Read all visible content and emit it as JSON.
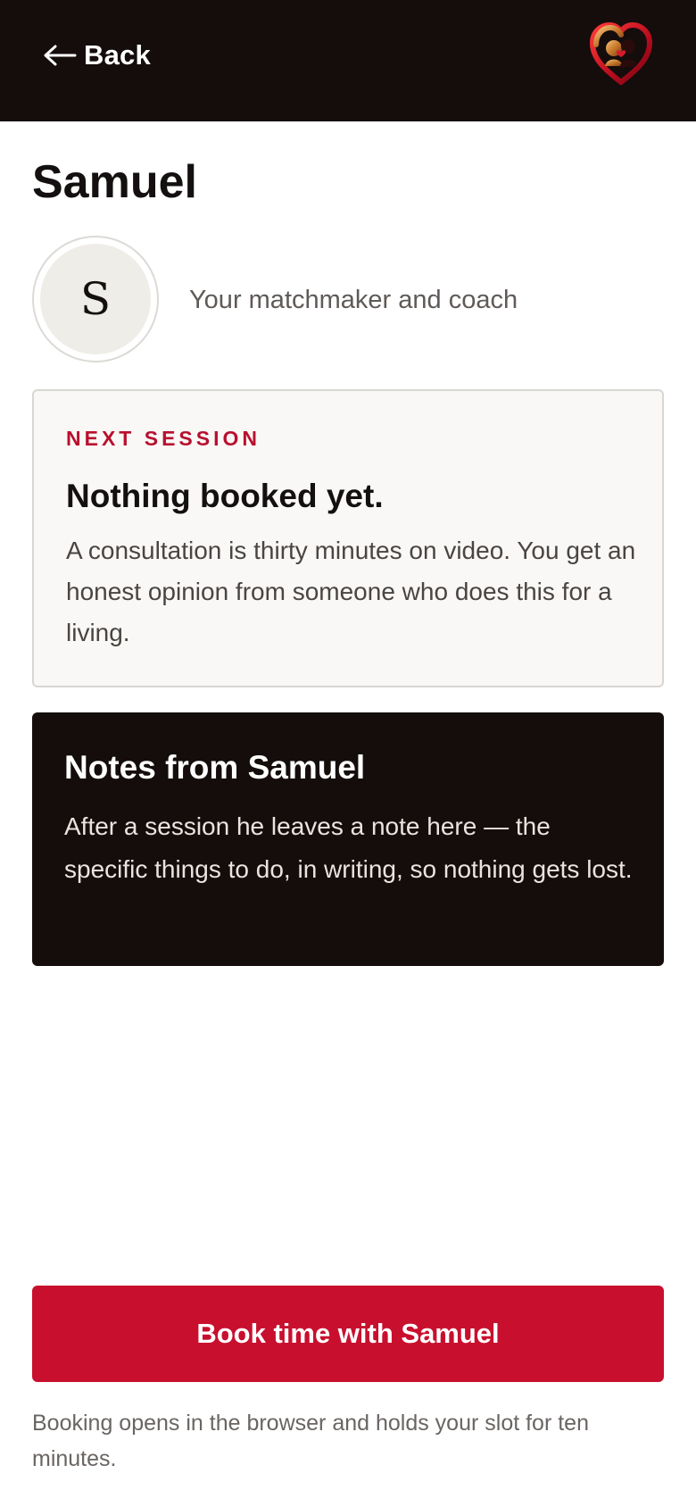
{
  "header": {
    "back_label": "Back",
    "logo_icon": "heart-couple-logo-icon"
  },
  "profile": {
    "name": "Samuel",
    "avatar_initial": "S",
    "role": "Your matchmaker and coach"
  },
  "next_session": {
    "eyebrow": "NEXT SESSION",
    "heading": "Nothing booked yet.",
    "body": "A consultation is thirty minutes on video. You get an honest opinion from someone who does this for a living."
  },
  "notes": {
    "heading": "Notes from Samuel",
    "body": "After a session he leaves a note here — the specific things to do, in writing, so nothing gets lost."
  },
  "booking": {
    "button_label": "Book time with Samuel",
    "footnote": "Booking opens in the browser and holds your slot for ten minutes."
  },
  "colors": {
    "header_bg": "#140d0c",
    "accent_red": "#c8102e",
    "eyebrow_red": "#b8102f",
    "card_bg": "#f9f8f6",
    "notes_bg": "#140d0c"
  }
}
